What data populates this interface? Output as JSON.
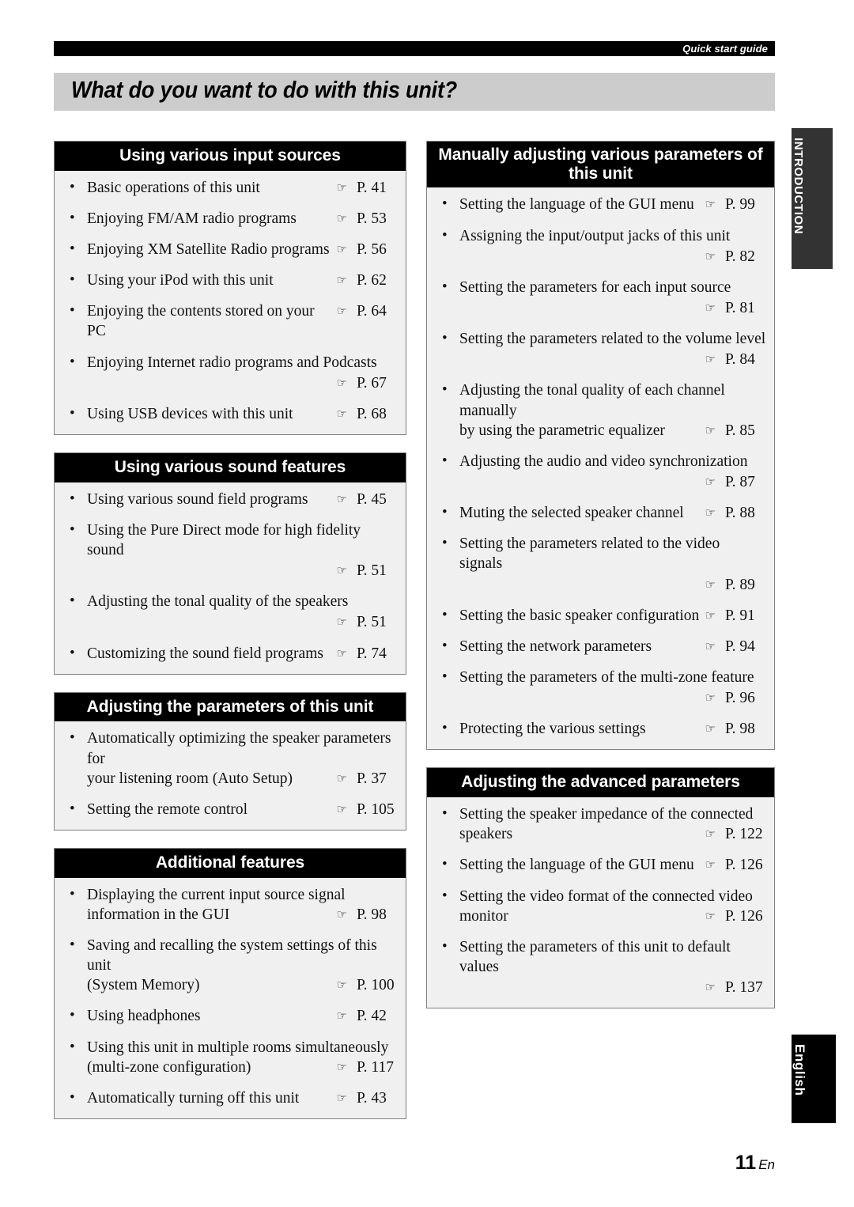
{
  "header": {
    "running_head": "Quick start guide",
    "page_title": "What do you want to do with this unit?"
  },
  "tabs": {
    "section_tab": "INTRODUCTION",
    "language_tab": "English"
  },
  "footer": {
    "page_number": "11",
    "language_code": "En"
  },
  "icons": {
    "pointing_hand": "☞",
    "bullet": "•"
  },
  "columns": {
    "left": [
      {
        "title": "Using various input sources",
        "items": [
          {
            "label": "Basic operations of this unit",
            "page": "P. 41",
            "wrap": false
          },
          {
            "label": "Enjoying FM/AM radio programs",
            "page": "P. 53",
            "wrap": false
          },
          {
            "label": "Enjoying XM Satellite Radio programs",
            "page": "P. 56",
            "wrap": false
          },
          {
            "label": "Using your iPod with this unit",
            "page": "P. 62",
            "wrap": false
          },
          {
            "label": "Enjoying the contents stored on your PC",
            "page": "P. 64",
            "wrap": false
          },
          {
            "label": "Enjoying Internet radio programs and Podcasts",
            "page": "P. 67",
            "wrap": true
          },
          {
            "label": "Using USB devices with this unit",
            "page": "P. 68",
            "wrap": false
          }
        ]
      },
      {
        "title": "Using various sound features",
        "items": [
          {
            "label": "Using various sound field programs",
            "page": "P. 45",
            "wrap": false
          },
          {
            "label": "Using the Pure Direct mode for high fidelity sound",
            "page": "P. 51",
            "wrap": true
          },
          {
            "label": "Adjusting the tonal quality of the speakers",
            "page": "P. 51",
            "wrap": true
          },
          {
            "label": "Customizing the sound field programs",
            "page": "P. 74",
            "wrap": false
          }
        ]
      },
      {
        "title": "Adjusting the parameters of this unit",
        "items": [
          {
            "label": "Automatically optimizing the speaker parameters for",
            "label_cont": "your listening room (Auto Setup)",
            "page": "P. 37",
            "wrap": false
          },
          {
            "label": "Setting the remote control",
            "page": "P. 105",
            "wrap": false
          }
        ]
      },
      {
        "title": "Additional features",
        "items": [
          {
            "label": "Displaying the current input source signal",
            "label_cont": "information in the GUI",
            "page": "P. 98",
            "wrap": false
          },
          {
            "label": "Saving and recalling the system settings of this unit",
            "label_cont": "(System Memory)",
            "page": "P. 100",
            "wrap": false
          },
          {
            "label": "Using headphones",
            "page": "P. 42",
            "wrap": false
          },
          {
            "label": "Using this unit in multiple rooms simultaneously",
            "label_cont": "(multi-zone configuration)",
            "page": "P. 117",
            "wrap": false
          },
          {
            "label": "Automatically turning off this unit",
            "page": "P. 43",
            "wrap": false
          }
        ]
      }
    ],
    "right": [
      {
        "title": "Manually adjusting various parameters of this unit",
        "items": [
          {
            "label": "Setting the language of the GUI menu",
            "page": "P. 99",
            "wrap": false
          },
          {
            "label": "Assigning the input/output jacks of this unit",
            "page": "P. 82",
            "wrap": true
          },
          {
            "label": "Setting the parameters for each input source",
            "page": "P. 81",
            "wrap": true
          },
          {
            "label": "Setting the parameters related to the volume level",
            "page": "P. 84",
            "wrap": true
          },
          {
            "label": "Adjusting the tonal quality of each channel manually",
            "label_cont": "by using the parametric equalizer",
            "page": "P. 85",
            "wrap": false
          },
          {
            "label": "Adjusting the audio and video synchronization",
            "page": "P. 87",
            "wrap": true
          },
          {
            "label": "Muting the selected speaker channel",
            "page": "P. 88",
            "wrap": false
          },
          {
            "label": "Setting the parameters related to the video signals",
            "page": "P. 89",
            "wrap": true
          },
          {
            "label": "Setting the basic speaker configuration",
            "page": "P. 91",
            "wrap": false
          },
          {
            "label": "Setting the network parameters",
            "page": "P. 94",
            "wrap": false
          },
          {
            "label": "Setting the parameters of the multi-zone feature",
            "page": "P. 96",
            "wrap": true
          },
          {
            "label": "Protecting the various settings",
            "page": "P. 98",
            "wrap": false
          }
        ]
      },
      {
        "title": "Adjusting the advanced parameters",
        "items": [
          {
            "label": "Setting the speaker impedance of the connected",
            "label_cont": "speakers",
            "page": "P. 122",
            "wrap": false
          },
          {
            "label": "Setting the language of the GUI menu",
            "page": "P. 126",
            "wrap": false
          },
          {
            "label": "Setting the video format of the connected video",
            "label_cont": "monitor",
            "page": "P. 126",
            "wrap": false
          },
          {
            "label": "Setting the parameters of this unit to default values",
            "page": "P. 137",
            "wrap": true
          }
        ]
      }
    ]
  }
}
